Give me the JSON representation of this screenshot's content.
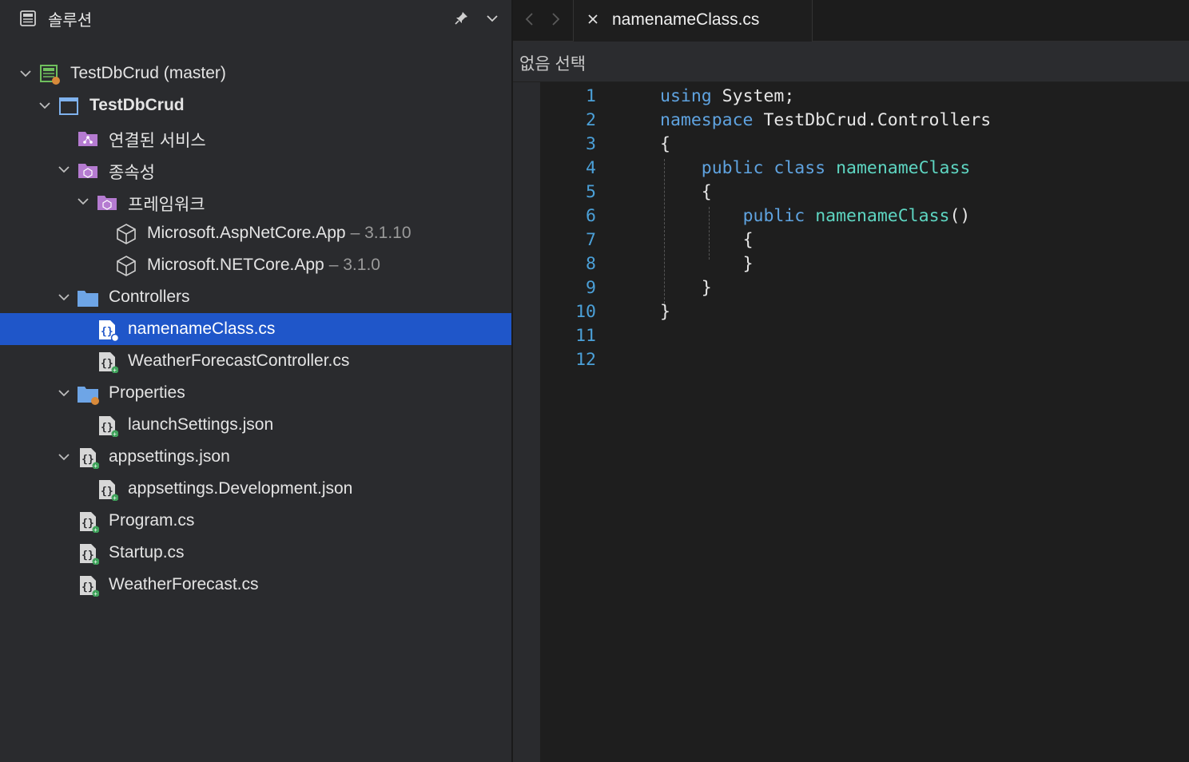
{
  "solution_pad": {
    "title": "솔루션",
    "tree": [
      {
        "label": "TestDbCrud (master)",
        "icon": "solution-icon",
        "expanded": true
      },
      {
        "label": "TestDbCrud",
        "icon": "project-icon",
        "expanded": true
      },
      {
        "label": "연결된 서비스",
        "icon": "connected-services-folder-icon"
      },
      {
        "label": "종속성",
        "icon": "dependencies-folder-icon",
        "expanded": true
      },
      {
        "label": "프레임워크",
        "icon": "frameworks-folder-icon",
        "expanded": true
      },
      {
        "label": "Microsoft.AspNetCore.App",
        "version": "– 3.1.10",
        "icon": "package-icon"
      },
      {
        "label": "Microsoft.NETCore.App",
        "version": "– 3.1.0",
        "icon": "package-icon"
      },
      {
        "label": "Controllers",
        "icon": "folder-icon",
        "expanded": true
      },
      {
        "label": "namenameClass.cs",
        "icon": "csharp-file-icon",
        "selected": true
      },
      {
        "label": "WeatherForecastController.cs",
        "icon": "csharp-file-icon"
      },
      {
        "label": "Properties",
        "icon": "properties-folder-icon",
        "expanded": true
      },
      {
        "label": "launchSettings.json",
        "icon": "json-file-icon"
      },
      {
        "label": "appsettings.json",
        "icon": "json-file-icon",
        "expanded": true
      },
      {
        "label": "appsettings.Development.json",
        "icon": "json-file-icon"
      },
      {
        "label": "Program.cs",
        "icon": "csharp-file-icon"
      },
      {
        "label": "Startup.cs",
        "icon": "csharp-file-icon"
      },
      {
        "label": "WeatherForecast.cs",
        "icon": "csharp-file-icon"
      }
    ]
  },
  "editor": {
    "active_tab": "namenameClass.cs",
    "breadcrumb": "없음 선택",
    "line_numbers": [
      "1",
      "2",
      "3",
      "4",
      "5",
      "6",
      "7",
      "8",
      "9",
      "10",
      "11",
      "12"
    ],
    "code": [
      {
        "kw": "using",
        "rest": " System;"
      },
      {
        "kw": "namespace",
        "rest": " TestDbCrud.Controllers"
      },
      {
        "rest": "{"
      },
      {
        "indent": "    ",
        "kw": "public class",
        "ty": "namenameClass"
      },
      {
        "indent": "    ",
        "rest": "{"
      },
      {
        "indent": "        ",
        "kw": "public",
        "ty": "namenameClass",
        "rest": "()"
      },
      {
        "indent": "        ",
        "rest": "{"
      },
      {
        "indent": "        ",
        "rest": "}"
      },
      {
        "indent": "    ",
        "rest": "}"
      },
      {
        "rest": "}"
      },
      {
        "rest": ""
      },
      {
        "rest": ""
      }
    ]
  },
  "colors": {
    "selection": "#1f56c9",
    "keyword": "#5fa3e0",
    "type": "#5ed6c2",
    "line_number": "#4ba0d8"
  }
}
